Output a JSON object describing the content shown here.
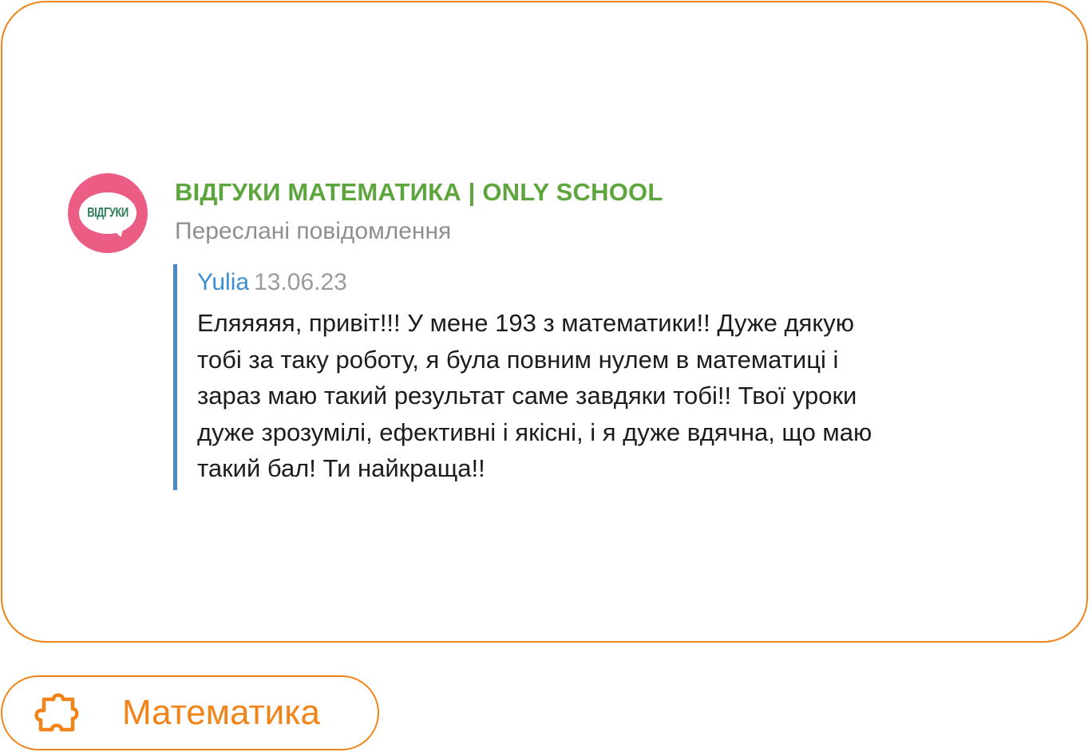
{
  "colors": {
    "accent": "#f08418",
    "channel_name": "#5da63d",
    "avatar_bg": "#eb5d85",
    "quote_bar": "#4a8ac4",
    "author": "#3d8ed0",
    "muted": "#8e8e93",
    "text": "#1c1c1e"
  },
  "message": {
    "avatar_text": "ВІДГУКИ",
    "channel_name": "ВІДГУКИ МАТЕМАТИКА | ONLY SCHOOL",
    "forwarded_label": "Переслані повідомлення",
    "quote": {
      "author": "Yulia",
      "date": "13.06.23",
      "lines": [
        "Еляяяяя, привіт!!! У мене 193 з математики!! Дуже дякую",
        "тобі за таку роботу, я була повним нулем в математиці і",
        "зараз маю такий результат саме завдяки тобі!! Твої уроки",
        "дуже зрозумілі, ефективні і якісні, і я дуже вдячна, що маю",
        "такий бал! Ти найкраща!!"
      ]
    }
  },
  "tag": {
    "icon": "puzzle-piece-icon",
    "label": "Математика"
  }
}
